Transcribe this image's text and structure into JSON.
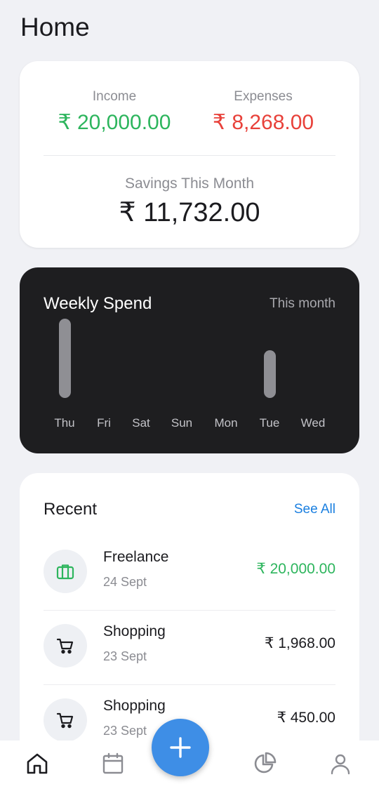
{
  "page": {
    "title": "Home"
  },
  "summary": {
    "income_label": "Income",
    "income_value": "₹ 20,000.00",
    "expenses_label": "Expenses",
    "expenses_value": "₹ 8,268.00",
    "savings_label": "Savings This Month",
    "savings_value": "₹ 11,732.00"
  },
  "weekly": {
    "title": "Weekly Spend",
    "range": "This month",
    "days": [
      {
        "label": "Thu",
        "fraction": 1.0
      },
      {
        "label": "Fri",
        "fraction": 0
      },
      {
        "label": "Sat",
        "fraction": 0
      },
      {
        "label": "Sun",
        "fraction": 0
      },
      {
        "label": "Mon",
        "fraction": 0
      },
      {
        "label": "Tue",
        "fraction": 0.6
      },
      {
        "label": "Wed",
        "fraction": 0
      }
    ]
  },
  "recent": {
    "title": "Recent",
    "see_all": "See All",
    "transactions": [
      {
        "name": "Freelance",
        "date": "24 Sept",
        "amount": "₹ 20,000.00",
        "icon": "briefcase-icon"
      },
      {
        "name": "Shopping",
        "date": "23 Sept",
        "amount": "₹ 1,968.00",
        "icon": "cart-icon"
      },
      {
        "name": "Shopping",
        "date": "23 Sept",
        "amount": "₹ 450.00",
        "icon": "cart-icon"
      }
    ]
  },
  "nav": {
    "items": [
      "home-icon",
      "calendar-icon",
      "add-icon",
      "pie-chart-icon",
      "profile-icon"
    ]
  },
  "colors": {
    "income": "#2db55d",
    "expense": "#e8413a",
    "accent": "#3e8ee6",
    "link": "#1a7fe0"
  }
}
